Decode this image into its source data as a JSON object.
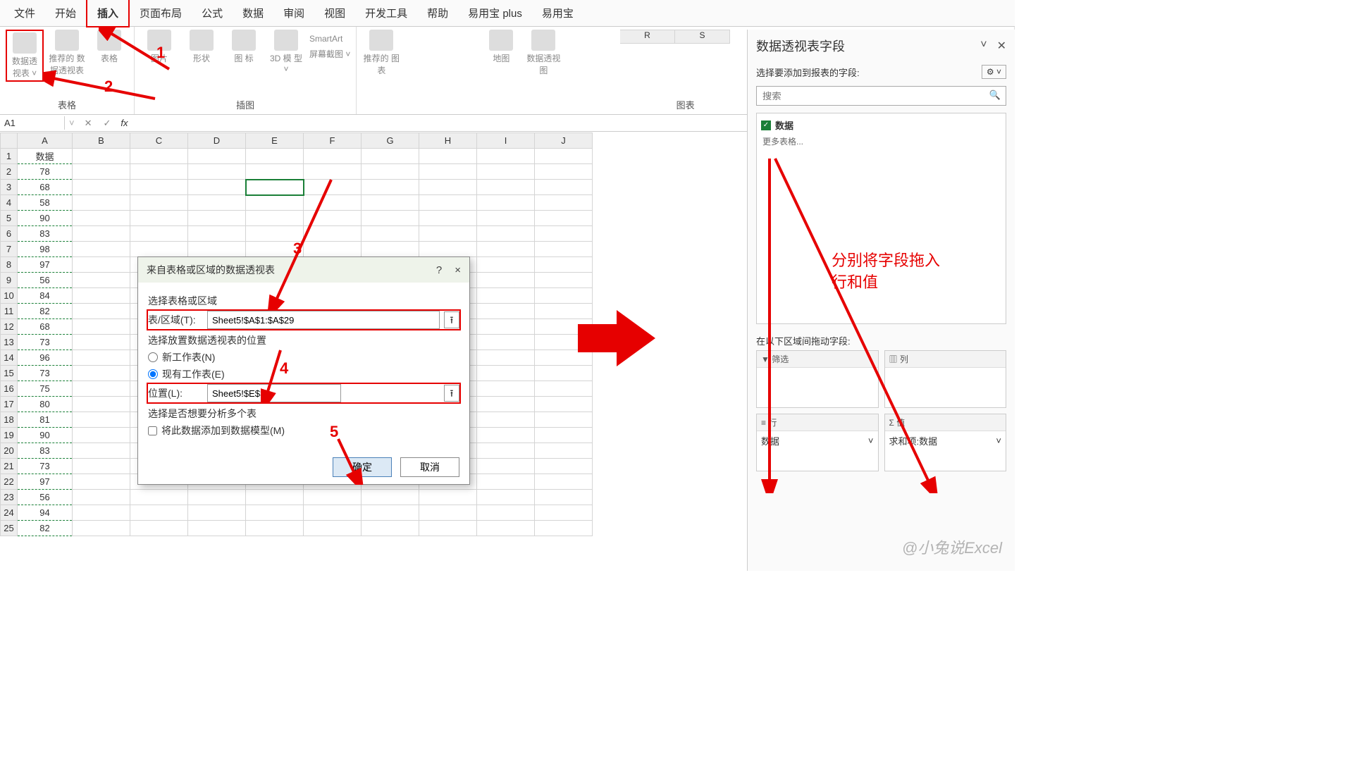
{
  "ribbon_tabs": [
    "文件",
    "开始",
    "插入",
    "页面布局",
    "公式",
    "数据",
    "审阅",
    "视图",
    "开发工具",
    "帮助",
    "易用宝 plus",
    "易用宝"
  ],
  "active_tab_index": 2,
  "groups": {
    "tables": {
      "label": "表格",
      "items": [
        "数据透\n视表 ˅",
        "推荐的\n数据透视表",
        "表格"
      ]
    },
    "illus": {
      "label": "插图",
      "items": [
        "图片",
        "形状",
        "图\n标",
        "3D 模\n型 ˅"
      ],
      "extra": [
        "SmartArt",
        "屏幕截图 ˅"
      ]
    },
    "charts": {
      "label": "图表",
      "items": [
        "推荐的\n图表",
        "",
        "",
        "",
        "地图",
        "数据透视图"
      ]
    }
  },
  "namebox": "A1",
  "fx": "fx",
  "columns": [
    "A",
    "B",
    "C",
    "D",
    "E",
    "F",
    "G",
    "H",
    "I",
    "J"
  ],
  "right_cols": [
    "R",
    "S"
  ],
  "row_header": "数据",
  "col_a_values": [
    78,
    68,
    58,
    90,
    83,
    98,
    97,
    56,
    84,
    82,
    68,
    73,
    96,
    73,
    75,
    80,
    81,
    90,
    83,
    73,
    97,
    56,
    94,
    82
  ],
  "selected_cell": "E3",
  "dialog": {
    "title": "来自表格或区域的数据透视表",
    "help": "?",
    "close": "×",
    "sec1": "选择表格或区域",
    "range_lbl": "表/区域(T):",
    "range_val": "Sheet5!$A$1:$A$29",
    "sec2": "选择放置数据透视表的位置",
    "opt_new": "新工作表(N)",
    "opt_exist": "现有工作表(E)",
    "loc_lbl": "位置(L):",
    "loc_val": "Sheet5!$E$3",
    "sec3": "选择是否想要分析多个表",
    "model_chk": "将此数据添加到数据模型(M)",
    "ok": "确定",
    "cancel": "取消"
  },
  "pane": {
    "title": "数据透视表字段",
    "sub": "选择要添加到报表的字段:",
    "search_ph": "搜索",
    "field": "数据",
    "more": "更多表格...",
    "drag_lbl": "在以下区域间拖动字段:",
    "z_filter": "筛选",
    "z_col": "列",
    "z_row": "行",
    "z_val": "值",
    "row_item": "数据",
    "val_item": "求和项:数据"
  },
  "annotations": {
    "n1": "1",
    "n2": "2",
    "n3": "3",
    "n4": "4",
    "n5": "5",
    "hint": "分别将字段拖入\n行和值"
  },
  "watermark": "@小兔说Excel",
  "chart_data": {
    "type": "table",
    "title": "数据",
    "columns": [
      "数据"
    ],
    "values": [
      78,
      68,
      58,
      90,
      83,
      98,
      97,
      56,
      84,
      82,
      68,
      73,
      96,
      73,
      75,
      80,
      81,
      90,
      83,
      73,
      97,
      56,
      94,
      82
    ]
  }
}
